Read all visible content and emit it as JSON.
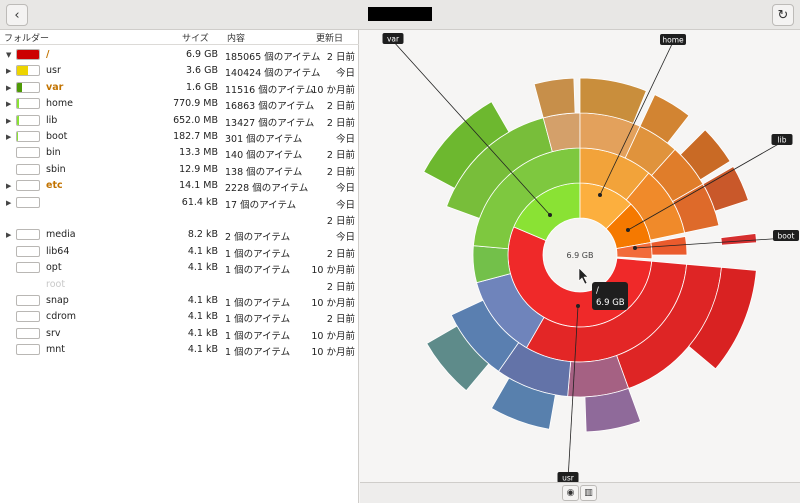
{
  "header": {
    "back_icon": "‹",
    "refresh_icon": "↻"
  },
  "columns": {
    "folder": "フォルダー",
    "size": "サイズ",
    "contents": "内容",
    "modified": "更新日"
  },
  "rows": [
    {
      "name": "/",
      "size": "6.9 GB",
      "contents": "185065 個のアイテム",
      "modified": "2 日前",
      "expander": "▼",
      "usage": 1.0,
      "color": "#cc0000",
      "name_color": "#c27300"
    },
    {
      "name": "usr",
      "size": "3.6 GB",
      "contents": "140424 個のアイテム",
      "modified": "今日",
      "expander": "▶",
      "usage": 0.52,
      "color": "#edd400",
      "name_color": "#222222"
    },
    {
      "name": "var",
      "size": "1.6 GB",
      "contents": "11516 個のアイテム",
      "modified": "10 か月前",
      "expander": "▶",
      "usage": 0.23,
      "color": "#4e9a06",
      "name_color": "#c27300"
    },
    {
      "name": "home",
      "size": "770.9 MB",
      "contents": "16863 個のアイテム",
      "modified": "2 日前",
      "expander": "▶",
      "usage": 0.11,
      "color": "#8ae234",
      "name_color": "#222222"
    },
    {
      "name": "lib",
      "size": "652.0 MB",
      "contents": "13427 個のアイテム",
      "modified": "2 日前",
      "expander": "▶",
      "usage": 0.09,
      "color": "#8ae234",
      "name_color": "#222222"
    },
    {
      "name": "boot",
      "size": "182.7 MB",
      "contents": "301 個のアイテム",
      "modified": "今日",
      "expander": "▶",
      "usage": 0.03,
      "color": "#8ae234",
      "name_color": "#222222"
    },
    {
      "name": "bin",
      "size": "13.3 MB",
      "contents": "140 個のアイテム",
      "modified": "2 日前",
      "expander": "",
      "usage": 0,
      "color": "#8ae234",
      "name_color": "#222222"
    },
    {
      "name": "sbin",
      "size": "12.9 MB",
      "contents": "138 個のアイテム",
      "modified": "2 日前",
      "expander": "",
      "usage": 0,
      "color": "#8ae234",
      "name_color": "#222222"
    },
    {
      "name": "etc",
      "size": "14.1 MB",
      "contents": "2228 個のアイテム",
      "modified": "今日",
      "expander": "▶",
      "usage": 0,
      "color": "#8ae234",
      "name_color": "#c27300"
    },
    {
      "name": "",
      "size": "61.4 kB",
      "contents": "17 個のアイテム",
      "modified": "今日",
      "expander": "▶",
      "usage": 0,
      "color": "#8ae234",
      "name_color": "#222222"
    },
    {
      "name": "",
      "size": "",
      "contents": "",
      "modified": "2 日前",
      "expander": "",
      "usage": 0,
      "color": "",
      "name_color": "#222222",
      "nobar": true
    },
    {
      "name": "media",
      "size": "8.2 kB",
      "contents": "2 個のアイテム",
      "modified": "今日",
      "expander": "▶",
      "usage": 0,
      "color": "#8ae234",
      "name_color": "#222222"
    },
    {
      "name": "lib64",
      "size": "4.1 kB",
      "contents": "1 個のアイテム",
      "modified": "2 日前",
      "expander": "",
      "usage": 0,
      "color": "#8ae234",
      "name_color": "#222222"
    },
    {
      "name": "opt",
      "size": "4.1 kB",
      "contents": "1 個のアイテム",
      "modified": "10 か月前",
      "expander": "",
      "usage": 0,
      "color": "#8ae234",
      "name_color": "#222222"
    },
    {
      "name": "root",
      "size": "",
      "contents": "",
      "modified": "2 日前",
      "expander": "",
      "usage": 0,
      "color": "",
      "name_color": "#c8c8c8",
      "nobar": true
    },
    {
      "name": "snap",
      "size": "4.1 kB",
      "contents": "1 個のアイテム",
      "modified": "10 か月前",
      "expander": "",
      "usage": 0,
      "color": "#8ae234",
      "name_color": "#222222"
    },
    {
      "name": "cdrom",
      "size": "4.1 kB",
      "contents": "1 個のアイテム",
      "modified": "2 日前",
      "expander": "",
      "usage": 0,
      "color": "#8ae234",
      "name_color": "#222222"
    },
    {
      "name": "srv",
      "size": "4.1 kB",
      "contents": "1 個のアイテム",
      "modified": "10 か月前",
      "expander": "",
      "usage": 0,
      "color": "#8ae234",
      "name_color": "#222222"
    },
    {
      "name": "mnt",
      "size": "4.1 kB",
      "contents": "1 個のアイテム",
      "modified": "10 か月前",
      "expander": "",
      "usage": 0,
      "color": "#8ae234",
      "name_color": "#222222"
    }
  ],
  "ring_chart": {
    "center_label": "6.9 GB",
    "tooltip_name": "/",
    "tooltip_size": "6.9 GB",
    "callouts": [
      "var",
      "home",
      "lib",
      "boot",
      "usr"
    ]
  },
  "footer": {
    "ring_icon": "◉",
    "treemap_icon": "▥"
  }
}
